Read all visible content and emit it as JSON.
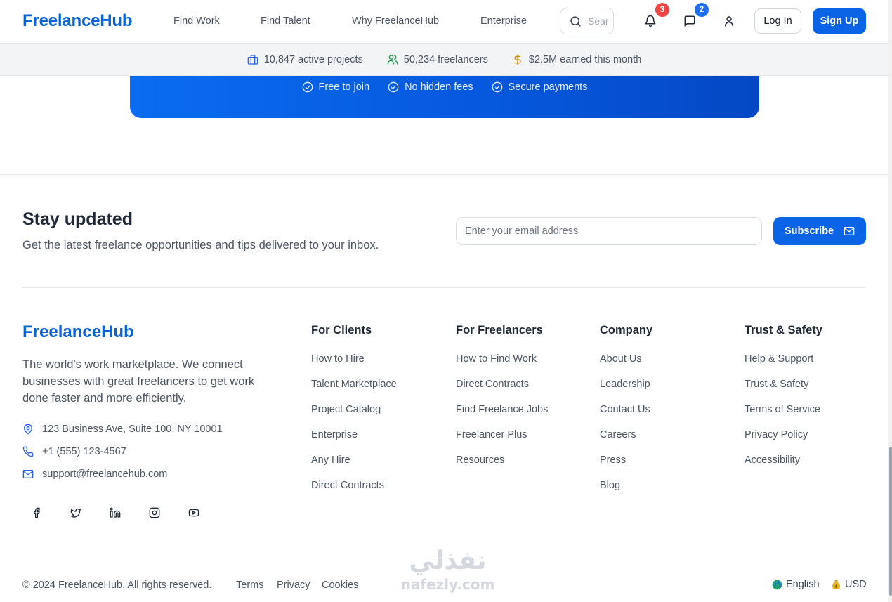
{
  "colors": {
    "brand": "#0b63d6",
    "accent": "#0b63e5",
    "text": "#1f2937",
    "muted": "#4b5563",
    "badge_red": "#ef4444",
    "badge_blue": "#1d6cf2"
  },
  "header": {
    "logo": "FreelanceHub",
    "nav": [
      "Find Work",
      "Find Talent",
      "Why FreelanceHub",
      "Enterprise"
    ],
    "search_placeholder": "Search",
    "notifications_count": "3",
    "messages_count": "2",
    "login_label": "Log In",
    "signup_label": "Sign Up"
  },
  "hero": {
    "badges": [
      "Free to join",
      "No hidden fees",
      "Secure payments"
    ]
  },
  "stats": [
    {
      "icon": "briefcase-icon",
      "text": "10,847 active projects"
    },
    {
      "icon": "users-icon",
      "text": "50,234 freelancers"
    },
    {
      "icon": "dollar-icon",
      "text": "$2.5M earned this month"
    }
  ],
  "newsletter": {
    "title": "Stay updated",
    "subtitle": "Get the latest freelance opportunities and tips delivered to your inbox.",
    "email_placeholder": "Enter your email address",
    "button_label": "Subscribe"
  },
  "footer": {
    "logo": "FreelanceHub",
    "description": "The world's work marketplace. We connect businesses with great freelancers to get work done faster and more efficiently.",
    "address": "123 Business Ave, Suite 100, NY 10001",
    "phone": "+1 (555) 123-4567",
    "email": "support@freelancehub.com",
    "social": [
      "facebook-icon",
      "twitter-icon",
      "linkedin-icon",
      "instagram-icon",
      "youtube-icon"
    ],
    "columns": [
      {
        "title": "For Clients",
        "links": [
          "How to Hire",
          "Talent Marketplace",
          "Project Catalog",
          "Enterprise",
          "Any Hire",
          "Direct Contracts"
        ]
      },
      {
        "title": "For Freelancers",
        "links": [
          "How to Find Work",
          "Direct Contracts",
          "Find Freelance Jobs",
          "Freelancer Plus",
          "Resources"
        ]
      },
      {
        "title": "Company",
        "links": [
          "About Us",
          "Leadership",
          "Contact Us",
          "Careers",
          "Press",
          "Blog"
        ]
      },
      {
        "title": "Trust & Safety",
        "links": [
          "Help & Support",
          "Trust & Safety",
          "Terms of Service",
          "Privacy Policy",
          "Accessibility"
        ]
      }
    ],
    "copyright": "© 2024 FreelanceHub. All rights reserved.",
    "bottom_links": [
      "Terms",
      "Privacy",
      "Cookies"
    ],
    "language": "English",
    "currency": "USD"
  },
  "watermark": {
    "arabic": "نفذلي",
    "latin": "nafezly.com"
  }
}
